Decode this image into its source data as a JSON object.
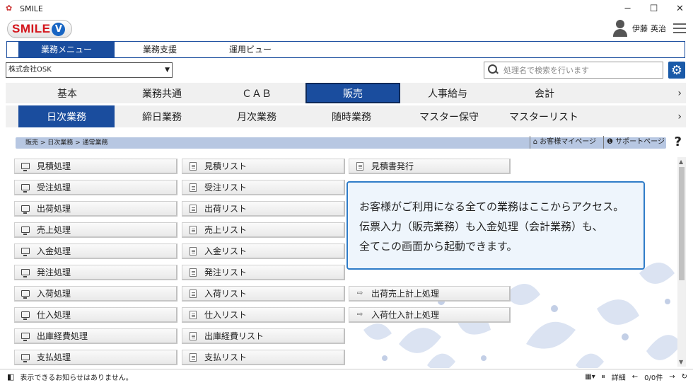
{
  "window": {
    "title": "SMILE",
    "min": "─",
    "max": "☐",
    "close": "✕"
  },
  "logo": {
    "text": "SMILE",
    "v": "V"
  },
  "user": {
    "last": "伊藤",
    "first": "英治"
  },
  "tabs": [
    "業務メニュー",
    "業務支援",
    "運用ビュー"
  ],
  "company": {
    "value": "株式会社OSK"
  },
  "search": {
    "placeholder": "処理名で検索を行います"
  },
  "categories": [
    "基本",
    "業務共通",
    "ＣＡＢ",
    "販売",
    "人事給与",
    "会計"
  ],
  "subcategories": [
    "日次業務",
    "締日業務",
    "月次業務",
    "随時業務",
    "マスター保守",
    "マスターリスト"
  ],
  "breadcrumb": "販売 > 日次業務 > 通常業務",
  "links": {
    "customer": "お客様マイページ",
    "support": "サポートページ"
  },
  "col1": [
    "見積処理",
    "受注処理",
    "出荷処理",
    "売上処理",
    "入金処理",
    "発注処理",
    "入荷処理",
    "仕入処理",
    "出庫経費処理",
    "支払処理"
  ],
  "col2": [
    "見積リスト",
    "受注リスト",
    "出荷リスト",
    "売上リスト",
    "入金リスト",
    "発注リスト",
    "入荷リスト",
    "仕入リスト",
    "出庫経費リスト",
    "支払リスト"
  ],
  "col3": {
    "quote_issue": "見積書発行",
    "ship_post": "出荷売上計上処理",
    "recv_post": "入荷仕入計上処理"
  },
  "info": {
    "line1": "お客様がご利用になる全ての業務はここからアクセス。",
    "line2": "伝票入力（販売業務）も入金処理（会計業務）も、",
    "line3": "全てこの画面から起動できます。"
  },
  "status": {
    "message": "表示できるお知らせはありません。",
    "detail": "詳細",
    "count": "0/0件"
  },
  "colors": {
    "accent": "#1a4d9e",
    "infobox_border": "#2f7cc8"
  }
}
